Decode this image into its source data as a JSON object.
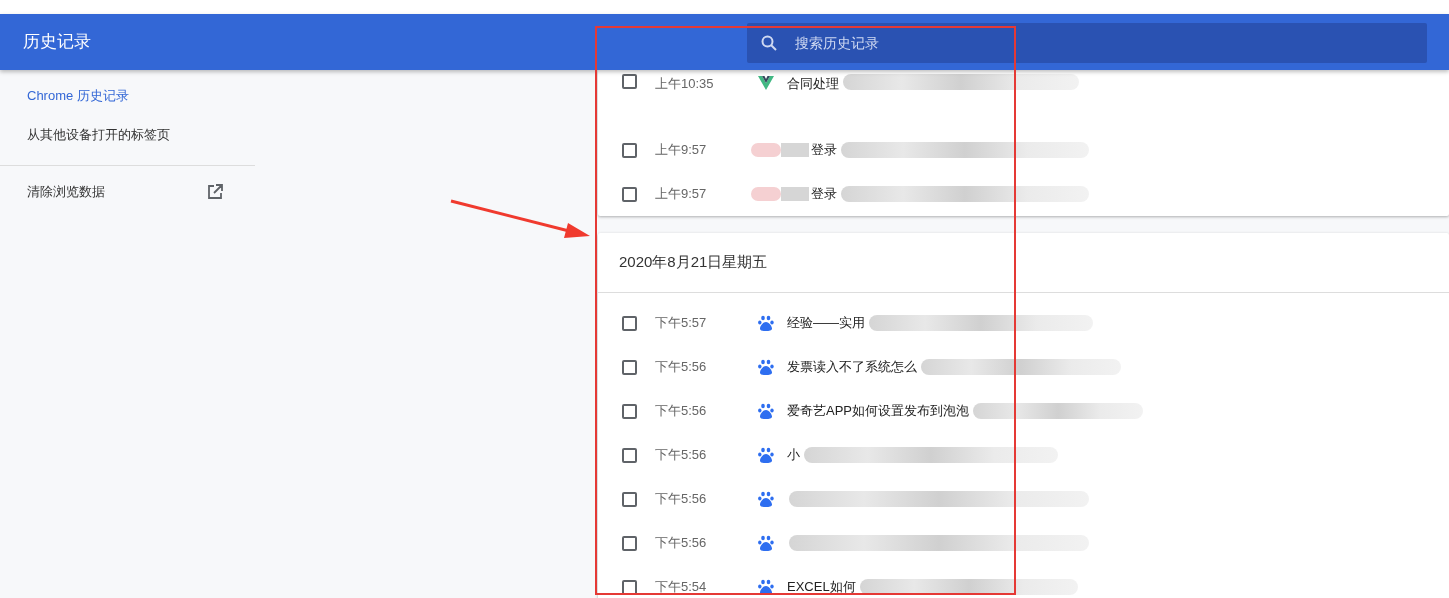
{
  "header": {
    "title": "历史记录",
    "search": {
      "placeholder": "搜索历史记录"
    }
  },
  "sidebar": {
    "items": [
      {
        "label": "Chrome 历史记录",
        "selected": true
      },
      {
        "label": "从其他设备打开的标签页",
        "selected": false
      }
    ],
    "clear_label": "清除浏览数据"
  },
  "groups": [
    {
      "entries": [
        {
          "time": "上午10:35",
          "kind": "vue",
          "title": "合同处理",
          "checked": false
        },
        {
          "time": "上午9:57",
          "kind": "redacted",
          "title": "登录",
          "checked": false
        },
        {
          "time": "上午9:57",
          "kind": "redacted",
          "title": "登录",
          "checked": false
        }
      ]
    },
    {
      "heading": "2020年8月21日星期五",
      "entries": [
        {
          "time": "下午5:57",
          "kind": "paw",
          "title": "经验——实用",
          "checked": false
        },
        {
          "time": "下午5:56",
          "kind": "paw",
          "title": "发票读入不了系统怎么",
          "checked": false
        },
        {
          "time": "下午5:56",
          "kind": "paw",
          "title": "爱奇艺APP如何设置发布到泡泡",
          "checked": false
        },
        {
          "time": "下午5:56",
          "kind": "paw",
          "title": "小",
          "checked": false
        },
        {
          "time": "下午5:56",
          "kind": "paw",
          "checked": false
        },
        {
          "time": "下午5:56",
          "kind": "paw",
          "checked": false
        },
        {
          "time": "下午5:54",
          "kind": "paw",
          "title": "EXCEL如何",
          "checked": false
        }
      ]
    }
  ]
}
